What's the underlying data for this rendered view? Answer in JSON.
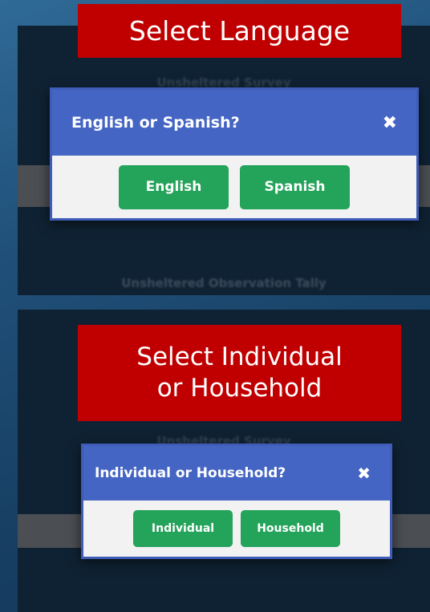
{
  "captions": {
    "top": "Select Language",
    "bottom_line1": "Select Individual",
    "bottom_line2": "or Household"
  },
  "background_text": {
    "top_survey": "Unsheltered Survey",
    "top_tally": "Unsheltered Observation Tally",
    "bottom_survey": "Unsheltered Survey"
  },
  "language_modal": {
    "title": "English or Spanish?",
    "close_icon": "close-icon",
    "buttons": [
      "English",
      "Spanish"
    ]
  },
  "household_modal": {
    "title": "Individual or Household?",
    "close_icon": "close-icon",
    "buttons": [
      "Individual",
      "Household"
    ]
  },
  "colors": {
    "caption_bg": "#c00000",
    "modal_header": "#4565c4",
    "button_green": "#24a35a",
    "panel_dark": "#0f2233"
  }
}
